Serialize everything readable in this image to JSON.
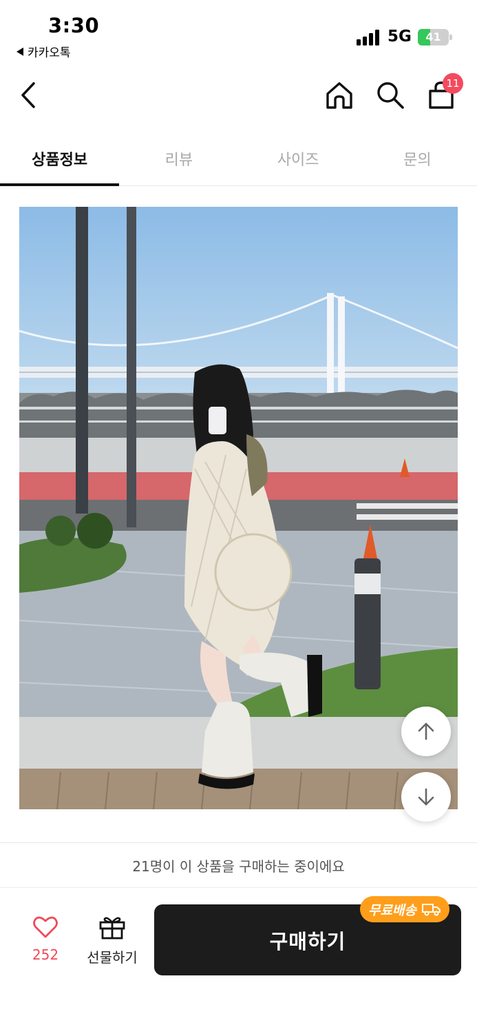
{
  "status_bar": {
    "time": "3:30",
    "back_app": "카카오톡",
    "network": "5G",
    "battery": "41",
    "battery_level": 0.41
  },
  "nav": {
    "cart_count": "11"
  },
  "tabs": [
    {
      "label": "상품정보",
      "active": true
    },
    {
      "label": "리뷰",
      "active": false
    },
    {
      "label": "사이즈",
      "active": false
    },
    {
      "label": "문의",
      "active": false
    }
  ],
  "notice": "21명이 이 상품을 구매하는 중이에요",
  "bottom_bar": {
    "like_count": "252",
    "gift_label": "선물하기",
    "buy_label": "구매하기",
    "free_shipping_badge": "무료배송"
  },
  "colors": {
    "accent_red": "#f04a5a",
    "badge_orange": "#ff9e1b",
    "buy_button": "#1c1c1c"
  }
}
